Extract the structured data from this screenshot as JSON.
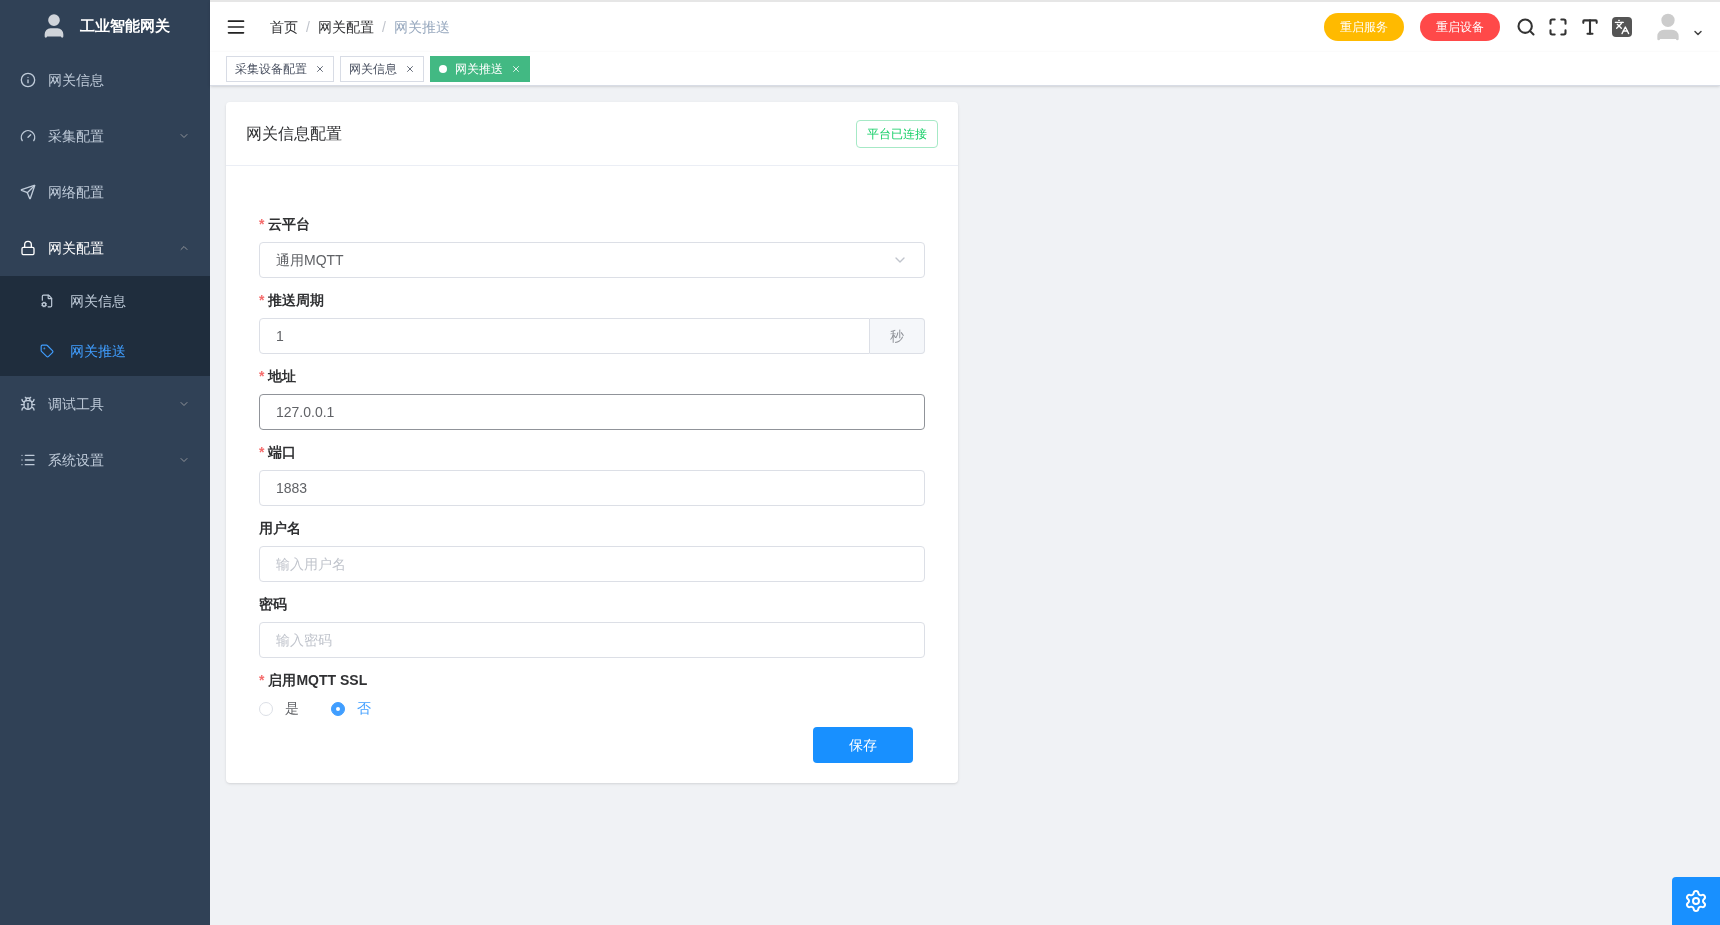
{
  "sidebar": {
    "title": "工业智能网关",
    "items": [
      {
        "label": "网关信息",
        "kind": "link"
      },
      {
        "label": "采集配置",
        "kind": "submenu",
        "expanded": false
      },
      {
        "label": "网络配置",
        "kind": "link"
      },
      {
        "label": "网关配置",
        "kind": "submenu",
        "expanded": true,
        "children": [
          {
            "label": "网关信息",
            "selected": false
          },
          {
            "label": "网关推送",
            "selected": true
          }
        ]
      },
      {
        "label": "调试工具",
        "kind": "submenu",
        "expanded": false
      },
      {
        "label": "系统设置",
        "kind": "submenu",
        "expanded": false
      }
    ]
  },
  "header": {
    "breadcrumb": [
      {
        "label": "首页"
      },
      {
        "separator": "/",
        "label": "网关配置"
      },
      {
        "separator": "/",
        "label": "网关推送"
      }
    ],
    "buttons": [
      {
        "label": "重启服务",
        "color": "#ffba00"
      },
      {
        "label": "重启设备",
        "color": "#ff4949"
      }
    ]
  },
  "tabs": [
    {
      "label": "采集设备配置",
      "selected": false
    },
    {
      "label": "网关信息",
      "selected": false
    },
    {
      "label": "网关推送",
      "selected": true
    }
  ],
  "card": {
    "title": "网关信息配置",
    "status": "平台已连接",
    "fields": [
      {
        "kind": "select",
        "label": "云平台",
        "required_mark": "*",
        "value": "通用MQTT"
      },
      {
        "kind": "input",
        "label": "推送周期",
        "required_mark": "*",
        "value": "1",
        "suffix": "秒",
        "focused": false
      },
      {
        "kind": "input",
        "label": "地址",
        "required_mark": "*",
        "value": "127.0.0.1",
        "focused": true
      },
      {
        "kind": "input",
        "label": "端口",
        "required_mark": "*",
        "value": "1883",
        "focused": false
      },
      {
        "kind": "input",
        "label": "用户名",
        "placeholder": "输入用户名",
        "focused": false
      },
      {
        "kind": "input",
        "label": "密码",
        "placeholder": "输入密码",
        "focused": false
      },
      {
        "kind": "radio",
        "label": "启用MQTT SSL",
        "required_mark": "*",
        "options": [
          {
            "label": "是",
            "selected": false
          },
          {
            "label": "否",
            "selected": true
          }
        ]
      }
    ],
    "save": "保存"
  }
}
